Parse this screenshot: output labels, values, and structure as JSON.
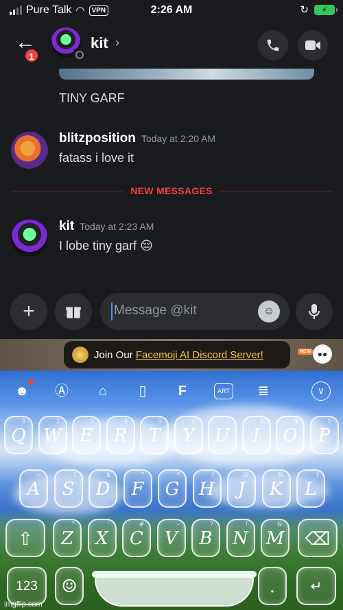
{
  "status_bar": {
    "carrier": "Pure Talk",
    "vpn": "VPN",
    "time": "2:26 AM"
  },
  "header": {
    "badge_count": "1",
    "title": "kit",
    "chevron": "›"
  },
  "messages": [
    {
      "text": "TINY GARF"
    },
    {
      "author": "blitzposition",
      "time": "Today at 2:20 AM",
      "text": "fatass i love it"
    },
    {
      "divider": "NEW MESSAGES"
    },
    {
      "author": "kit",
      "time": "Today at 2:23 AM",
      "text": "I lobe tiny garf 😔"
    }
  ],
  "composer": {
    "placeholder": "Message @kit"
  },
  "banner": {
    "prefix": "Join Our ",
    "link": "Facemoji AI Discord Server!",
    "new_tag": "NEW"
  },
  "keyboard": {
    "toolbar": [
      "emoji-face-icon",
      "translate-icon",
      "shirt-icon",
      "microphone-icon",
      "font-icon",
      "art-icon",
      "clipboard-icon",
      "chevron-down-icon"
    ],
    "toolbar_art_label": "ART",
    "row1": [
      {
        "k": "Q",
        "h": "1"
      },
      {
        "k": "W",
        "h": "2"
      },
      {
        "k": "E",
        "h": "3"
      },
      {
        "k": "R",
        "h": "4"
      },
      {
        "k": "T",
        "h": "5"
      },
      {
        "k": "Y",
        "h": "6"
      },
      {
        "k": "U",
        "h": "7"
      },
      {
        "k": "I",
        "h": "8"
      },
      {
        "k": "O",
        "h": "9"
      },
      {
        "k": "P",
        "h": "0"
      }
    ],
    "row2": [
      {
        "k": "A",
        "h": "~"
      },
      {
        "k": "S",
        "h": "!"
      },
      {
        "k": "D",
        "h": "$"
      },
      {
        "k": "F",
        "h": "^"
      },
      {
        "k": "G",
        "h": "*"
      },
      {
        "k": "H",
        "h": "("
      },
      {
        "k": "J",
        "h": "@"
      },
      {
        "k": "K",
        "h": "%"
      },
      {
        "k": "L",
        "h": ")"
      }
    ],
    "row3": [
      {
        "k": "Z",
        "h": "\""
      },
      {
        "k": "X",
        "h": "'"
      },
      {
        "k": "C",
        "h": "#"
      },
      {
        "k": "V",
        "h": "-"
      },
      {
        "k": "B",
        "h": "?"
      },
      {
        "k": "N",
        "h": "!"
      },
      {
        "k": "M",
        "h": "&"
      }
    ],
    "numbers_label": "123",
    "period_label": ".",
    "shift_symbol": "⇧",
    "delete_symbol": "⌫"
  },
  "watermark": "imgflip.com",
  "colors": {
    "background": "#1a1b1f",
    "accent_red": "#f23f43",
    "link_yellow": "#f7c94a",
    "battery_green": "#34c759"
  }
}
